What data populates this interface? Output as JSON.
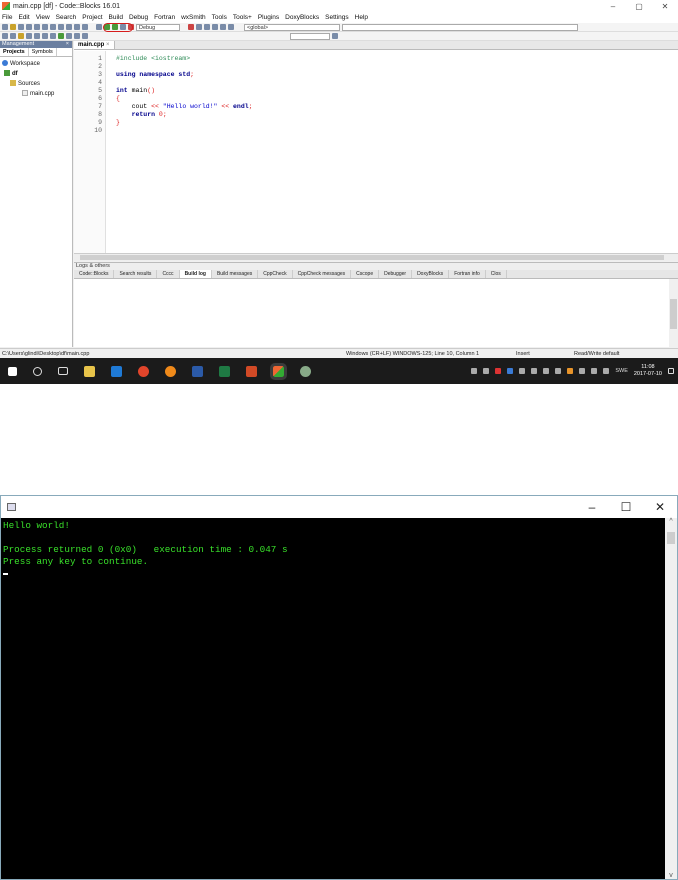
{
  "ide": {
    "title": "main.cpp [df] - Code::Blocks 16.01",
    "window_buttons": [
      "–",
      "▢",
      "✕"
    ],
    "menu": [
      "File",
      "Edit",
      "View",
      "Search",
      "Project",
      "Build",
      "Debug",
      "Fortran",
      "wxSmith",
      "Tools",
      "Tools+",
      "Plugins",
      "DoxyBlocks",
      "Settings",
      "Help"
    ],
    "toolbar": {
      "build_target": "Debug",
      "scope": "<global>"
    },
    "management": {
      "header": "Management",
      "tabs": [
        "Projects",
        "Symbols"
      ],
      "tree": [
        "Workspace",
        "df",
        "Sources",
        "main.cpp"
      ]
    },
    "editor": {
      "tab": "main.cpp",
      "lines": [
        {
          "n": "1",
          "parts": [
            {
              "c": "pp",
              "t": "#include <iostream>"
            }
          ]
        },
        {
          "n": "2",
          "parts": []
        },
        {
          "n": "3",
          "parts": [
            {
              "c": "kw",
              "t": "using namespace "
            },
            {
              "c": "kw",
              "t": "std"
            },
            {
              "c": "op",
              "t": ";"
            }
          ]
        },
        {
          "n": "4",
          "parts": []
        },
        {
          "n": "5",
          "parts": [
            {
              "c": "kw",
              "t": "int "
            },
            {
              "c": "",
              "t": "main"
            },
            {
              "c": "op",
              "t": "()"
            }
          ]
        },
        {
          "n": "6",
          "parts": [
            {
              "c": "op",
              "t": "{"
            }
          ]
        },
        {
          "n": "7",
          "parts": [
            {
              "c": "",
              "t": "    cout "
            },
            {
              "c": "op",
              "t": "<< "
            },
            {
              "c": "str",
              "t": "\"Hello world!\""
            },
            {
              "c": "op",
              "t": " << "
            },
            {
              "c": "kw",
              "t": "endl"
            },
            {
              "c": "op",
              "t": ";"
            }
          ]
        },
        {
          "n": "8",
          "parts": [
            {
              "c": "kw",
              "t": "    return "
            },
            {
              "c": "op",
              "t": "0;"
            }
          ]
        },
        {
          "n": "9",
          "parts": [
            {
              "c": "op",
              "t": "}"
            }
          ]
        },
        {
          "n": "10",
          "parts": []
        }
      ]
    },
    "logs": {
      "header": "Logs & others",
      "tabs": [
        "Code::Blocks",
        "Search results",
        "Cccc",
        "Build log",
        "Build messages",
        "CppCheck",
        "CppCheck messages",
        "Cscope",
        "Debugger",
        "DoxyBlocks",
        "Fortran info",
        "Clos"
      ],
      "active_tab": "Build log"
    },
    "status": {
      "path": "C:\\Users\\glindi\\Desktop\\df\\main.cpp",
      "eol": "Windows (CR+LF) WINDOWS-125; Line 10, Column 1",
      "mode": "Insert",
      "access": "Read/Write default"
    },
    "taskbar": {
      "lang": "SWE",
      "time": "11:08",
      "date": "2017-07-10"
    }
  },
  "console": {
    "window_buttons": [
      "–",
      "☐",
      "✕"
    ],
    "lines": [
      "Hello world!",
      "",
      "Process returned 0 (0x0)   execution time : 0.047 s",
      "Press any key to continue."
    ]
  },
  "colors": {
    "console_text": "#39e02a",
    "highlight_ring": "#d61c1c"
  }
}
